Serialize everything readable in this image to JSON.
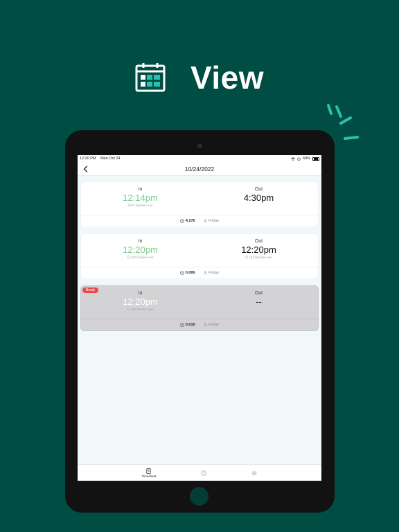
{
  "headline": {
    "title": "View",
    "icon": "calendar-icon"
  },
  "status_bar": {
    "time": "12:20 PM",
    "date": "Mon Oct 24",
    "battery": "69%"
  },
  "nav": {
    "title": "10/24/2022",
    "back_icon": "chevron-left-icon"
  },
  "entries": [
    {
      "in_label": "In",
      "in_time": "12:14pm",
      "in_location": "67 Division Ave",
      "out_label": "Out",
      "out_time": "4:30pm",
      "out_location": "",
      "hours": "4.27h",
      "day": "Friday",
      "badge": ""
    },
    {
      "in_label": "In",
      "in_time": "12:20pm",
      "in_location": "123 Division Ave",
      "out_label": "Out",
      "out_time": "12:20pm",
      "out_location": "123 Division Ave",
      "hours": "0.00h",
      "day": "Friday",
      "badge": ""
    },
    {
      "in_label": "In",
      "in_time": "12:20pm",
      "in_location": "123 Division Ave",
      "out_label": "Out",
      "out_time": "--",
      "out_location": "",
      "hours": "0.01h",
      "day": "Friday",
      "badge": "Break"
    }
  ],
  "tabs": [
    {
      "label": "Timesheet",
      "icon": "document-icon"
    },
    {
      "label": "",
      "icon": "clock-icon"
    },
    {
      "label": "",
      "icon": "gear-icon"
    }
  ],
  "colors": {
    "background": "#004d43",
    "in_time": "#7dcc8c",
    "badge": "#e94a4a",
    "accent": "#2bbfae"
  }
}
